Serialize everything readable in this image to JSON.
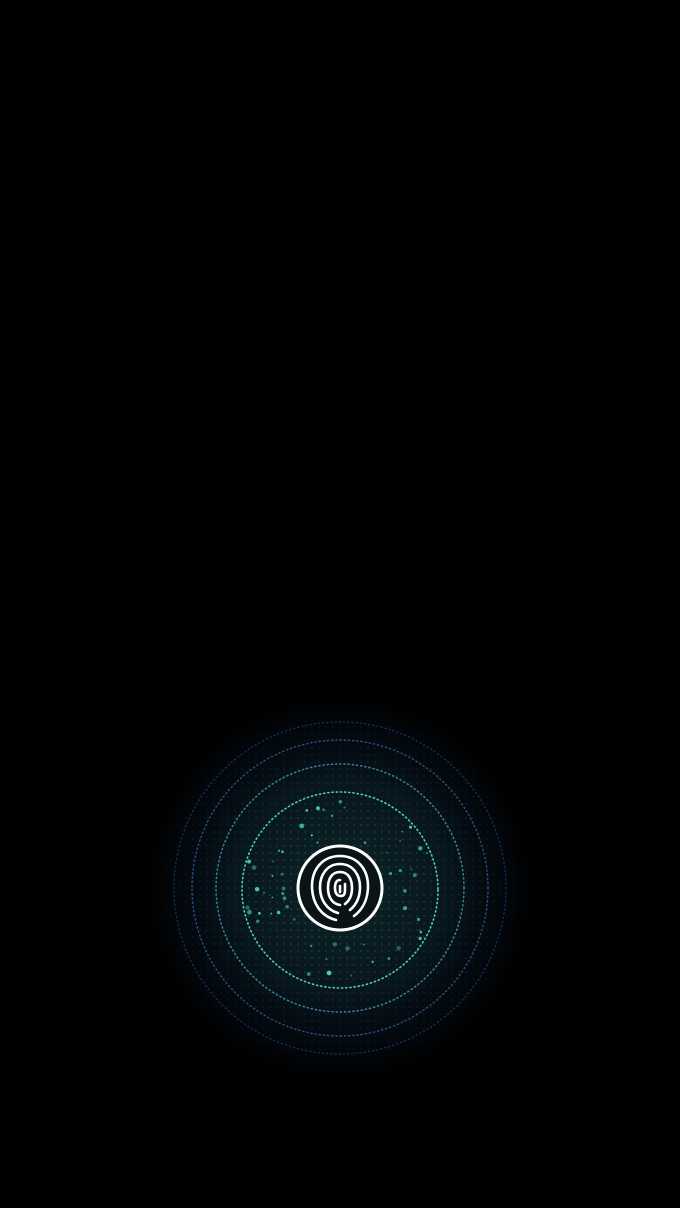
{
  "screen": {
    "background": "#000000"
  },
  "fingerprint_unlock": {
    "icon": "fingerprint-icon",
    "ring_color_inner": "#56e0c4",
    "ring_color_outer": "#2f6fd8",
    "dot_color": "#4fd8c0",
    "icon_color": "#ffffff"
  }
}
